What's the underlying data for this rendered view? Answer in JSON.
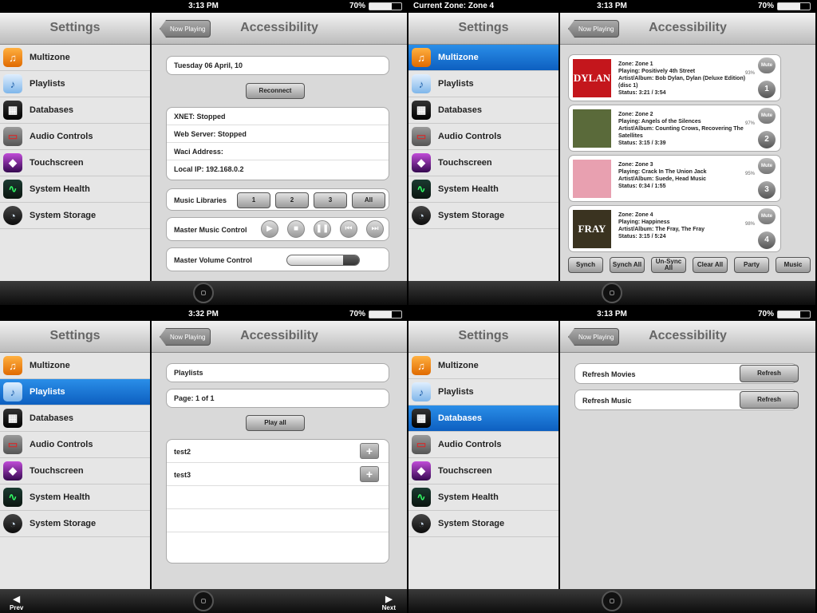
{
  "common": {
    "settings_title": "Settings",
    "main_title": "Accessibility",
    "back_label": "Now Playing",
    "battery": "70%",
    "sidebar": [
      {
        "label": "Multizone",
        "icon": "music-note-icon",
        "glyph": "♫"
      },
      {
        "label": "Playlists",
        "icon": "playlist-icon",
        "glyph": "♪"
      },
      {
        "label": "Databases",
        "icon": "film-clapper-icon",
        "glyph": "▦"
      },
      {
        "label": "Audio Controls",
        "icon": "stereo-icon",
        "glyph": "▭"
      },
      {
        "label": "Touchscreen",
        "icon": "touchscreen-icon",
        "glyph": "◆"
      },
      {
        "label": "System Health",
        "icon": "heartbeat-icon",
        "glyph": "∿"
      },
      {
        "label": "System Storage",
        "icon": "storage-icon",
        "glyph": "◔"
      }
    ]
  },
  "screen1": {
    "time": "3:13 PM",
    "date": "Tuesday 06 April, 10",
    "reconnect": "Reconnect",
    "info_rows": [
      "XNET: Stopped",
      "Web Server: Stopped",
      "Waci Address:",
      "Local IP: 192.168.0.2"
    ],
    "music_libraries_label": "Music Libraries",
    "library_buttons": [
      "1",
      "2",
      "3",
      "All"
    ],
    "master_music_label": "Master Music Control",
    "transport": [
      "play-icon",
      "stop-icon",
      "pause-icon",
      "rewind-icon",
      "fast-forward-icon"
    ],
    "master_volume_label": "Master Volume Control",
    "volume_level": 0.78
  },
  "screen2": {
    "time": "3:13 PM",
    "zone_label": "Current Zone: Zone 4",
    "selected": "Multizone",
    "zones": [
      {
        "zone": "Zone: Zone 1",
        "playing": "Playing: Positively 4th Street",
        "album": "Artist/Album: Bob Dylan, Dylan (Deluxe Edition) (disc 1)",
        "status": "Status: 3:21 / 3:54",
        "pct": "93%",
        "num": "1",
        "mute": "Mute",
        "art_text": "DYLAN",
        "art_color": "#c4161c"
      },
      {
        "zone": "Zone: Zone 2",
        "playing": "Playing: Angels of the Silences",
        "album": "Artist/Album: Counting Crows, Recovering The Satellites",
        "status": "Status: 3:15 / 3:39",
        "pct": "97%",
        "num": "2",
        "mute": "Mute",
        "art_text": "",
        "art_color": "#5a6a3a"
      },
      {
        "zone": "Zone: Zone 3",
        "playing": "Playing: Crack In The Union Jack",
        "album": "Artist/Album: Suede, Head Music",
        "status": "Status: 0:34 / 1:55",
        "pct": "95%",
        "num": "3",
        "mute": "Mute",
        "art_text": "",
        "art_color": "#e8a0b0"
      },
      {
        "zone": "Zone: Zone 4",
        "playing": "Playing: Happiness",
        "album": "Artist/Album: The Fray, The Fray",
        "status": "Status: 3:15 / 5:24",
        "pct": "98%",
        "num": "4",
        "mute": "Mute",
        "art_text": "FRAY",
        "art_color": "#3a3320"
      }
    ],
    "bottom_buttons": [
      "Synch",
      "Synch All",
      "Un-Sync All",
      "Clear All",
      "Party",
      "Music"
    ]
  },
  "screen3": {
    "time": "3:32 PM",
    "selected": "Playlists",
    "playlists_label": "Playlists",
    "page_label": "Page: 1 of 1",
    "play_all": "Play all",
    "items": [
      "test2",
      "test3"
    ],
    "prev": "Prev",
    "next": "Next"
  },
  "screen4": {
    "time": "3:13 PM",
    "selected": "Databases",
    "rows": [
      {
        "label": "Refresh Movies",
        "button": "Refresh"
      },
      {
        "label": "Refresh Music",
        "button": "Refresh"
      }
    ]
  }
}
